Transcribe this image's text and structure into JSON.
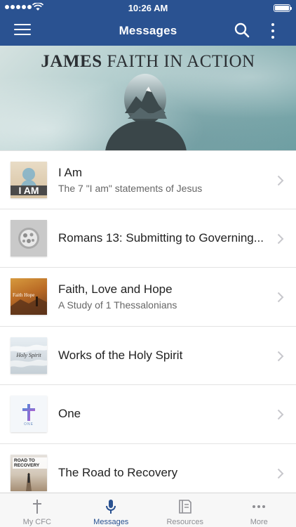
{
  "status": {
    "time": "10:26 AM"
  },
  "nav": {
    "title": "Messages"
  },
  "banner": {
    "title_bold": "JAMES",
    "title_rest": "FAITH IN ACTION"
  },
  "list": [
    {
      "title": "I Am",
      "subtitle": "The 7 \"I am\" statements of Jesus",
      "thumb_text": "I AM"
    },
    {
      "title": "Romans 13: Submitting to Governing...",
      "subtitle": ""
    },
    {
      "title": "Faith, Love and Hope",
      "subtitle": "A Study of 1 Thessalonians",
      "thumb_text": "Faith Hope"
    },
    {
      "title": "Works of the Holy Spirit",
      "subtitle": "",
      "thumb_text": "Holy Spirit"
    },
    {
      "title": "One",
      "subtitle": "",
      "thumb_text": "ONE"
    },
    {
      "title": "The Road to Recovery",
      "subtitle": "",
      "thumb_text": "ROAD TO RECOVERY"
    }
  ],
  "tabs": [
    {
      "label": "My CFC",
      "icon": "cross-icon"
    },
    {
      "label": "Messages",
      "icon": "microphone-icon",
      "active": true
    },
    {
      "label": "Resources",
      "icon": "book-icon"
    },
    {
      "label": "More",
      "icon": "more-icon"
    }
  ],
  "colors": {
    "nav": "#2a5291",
    "active_tab": "#2a5291",
    "inactive_tab": "#8e8e93"
  }
}
